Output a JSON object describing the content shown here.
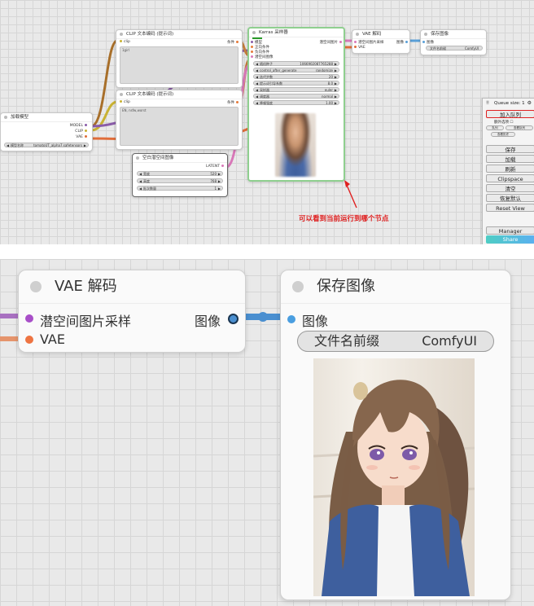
{
  "top": {
    "load_node": {
      "title": "加载模型",
      "outputs": [
        "MODEL",
        "CLIP",
        "VAE"
      ],
      "widget_label": "模型名称",
      "widget_value": "tomatoUT_alpha7.safetensors"
    },
    "clip_pos": {
      "title": "CLIP 文本编码 (提示词)",
      "input": "clip",
      "output": "条件",
      "text": "1girl"
    },
    "clip_neg": {
      "title": "CLIP 文本编码 (提示词)",
      "input": "clip",
      "output": "条件",
      "text": "EN, nsfw,worst"
    },
    "latent_node": {
      "title": "空白潜空间图像",
      "output": "LATENT",
      "widgets": [
        {
          "label": "宽度",
          "value": "520"
        },
        {
          "label": "高度",
          "value": "768"
        },
        {
          "label": "批次数量",
          "value": "1"
        }
      ]
    },
    "ksampler": {
      "title": "Karras 采样器",
      "inputs": [
        "模型",
        "正向条件",
        "负向条件",
        "潜空间图像"
      ],
      "output": "潜空间图片",
      "widgets": [
        {
          "label": "随机种子",
          "value": "1066902087765288"
        },
        {
          "label": "control_after_generate",
          "value": "randomize"
        },
        {
          "label": "迭代步数",
          "value": "20"
        },
        {
          "label": "提示词引导系数",
          "value": "8.0"
        },
        {
          "label": "采样器",
          "value": "euler"
        },
        {
          "label": "调度器",
          "value": "normal"
        },
        {
          "label": "降噪强度",
          "value": "1.00"
        }
      ]
    },
    "vae_small": {
      "title": "VAE 解码",
      "inputs": [
        "潜空间图片采样",
        "VAE"
      ],
      "output": "图像"
    },
    "save_small": {
      "title": "保存图像",
      "input": "图像",
      "widget_label": "文件名前缀",
      "widget_value": "ComfyUI"
    },
    "queue": {
      "title": "Queue size: 1",
      "primary": "加入队列",
      "extra_options": "额外选项",
      "small_buttons": [
        "队列",
        "查看队列",
        "查看历史"
      ],
      "buttons": [
        "保存",
        "加载",
        "刷新",
        "Clipspace",
        "清空",
        "恢复默认",
        "Reset View"
      ],
      "manager": "Manager",
      "share": "Share"
    },
    "annotation": "可以看到当前运行到哪个节点"
  },
  "bottom": {
    "vae_node": {
      "title": "VAE 解码",
      "input1": "潜空间图片采样",
      "input2": "VAE",
      "output": "图像"
    },
    "save_node": {
      "title": "保存图像",
      "input": "图像",
      "widget_label": "文件名前缀",
      "widget_value": "ComfyUI"
    }
  }
}
